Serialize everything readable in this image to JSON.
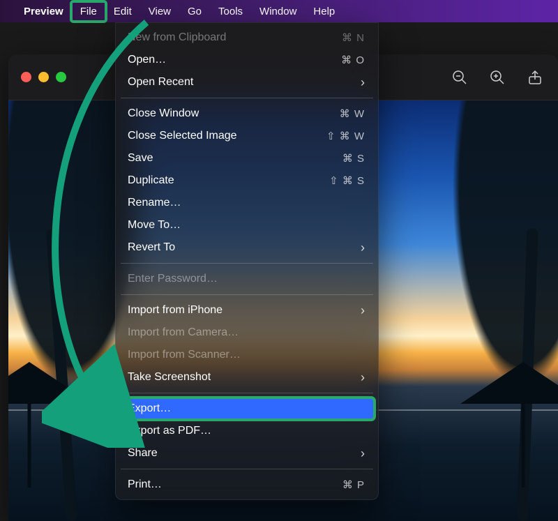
{
  "menubar": {
    "app": "Preview",
    "items": [
      "File",
      "Edit",
      "View",
      "Go",
      "Tools",
      "Window",
      "Help"
    ],
    "highlighted": "File"
  },
  "window": {
    "toolbar_icons": [
      "zoom-out-icon",
      "zoom-in-icon",
      "share-icon"
    ]
  },
  "dropdown": {
    "groups": [
      [
        {
          "label": "New from Clipboard",
          "shortcut": "⌘ N",
          "disabled": true
        },
        {
          "label": "Open…",
          "shortcut": "⌘ O"
        },
        {
          "label": "Open Recent",
          "chevron": true
        }
      ],
      [
        {
          "label": "Close Window",
          "shortcut": "⌘ W"
        },
        {
          "label": "Close Selected Image",
          "shortcut": "⇧ ⌘ W"
        },
        {
          "label": "Save",
          "shortcut": "⌘ S"
        },
        {
          "label": "Duplicate",
          "shortcut": "⇧ ⌘ S"
        },
        {
          "label": "Rename…"
        },
        {
          "label": "Move To…"
        },
        {
          "label": "Revert To",
          "chevron": true
        }
      ],
      [
        {
          "label": "Enter Password…",
          "disabled": true
        }
      ],
      [
        {
          "label": "Import from iPhone",
          "chevron": true
        },
        {
          "label": "Import from Camera…",
          "disabled": true
        },
        {
          "label": "Import from Scanner…",
          "disabled": true
        },
        {
          "label": "Take Screenshot",
          "chevron": true
        }
      ],
      [
        {
          "label": "Export…",
          "highlighted": true,
          "annot": true
        },
        {
          "label": "Export as PDF…"
        },
        {
          "label": "Share",
          "chevron": true
        }
      ],
      [
        {
          "label": "Print…",
          "shortcut": "⌘ P"
        }
      ]
    ]
  },
  "annotation": {
    "highlight_color": "#2aa76a",
    "arrow_from": "File",
    "arrow_to": "Export…"
  }
}
